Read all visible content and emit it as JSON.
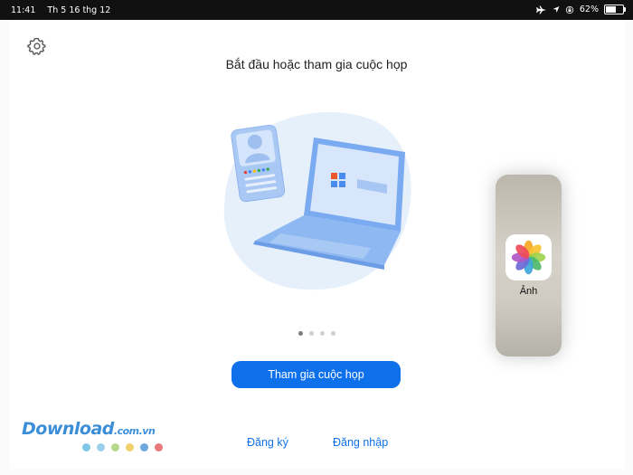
{
  "statusbar": {
    "time": "11:41",
    "date": "Th 5 16 thg 12",
    "battery": "62%",
    "battery_level": 0.62
  },
  "main": {
    "title": "Bắt đầu hoặc tham gia cuộc họp",
    "page_indicator": {
      "count": 4,
      "active": 0
    },
    "join_button": "Tham gia cuộc họp",
    "signup_link": "Đăng ký",
    "signin_link": "Đăng nhập"
  },
  "slideover": {
    "app_name": "Ảnh",
    "icon": "photos-app-icon"
  },
  "watermark": {
    "text_main": "Download",
    "text_domain": ".com.vn",
    "dot_colors": [
      "#7fc7e8",
      "#9bd0ea",
      "#b7d98d",
      "#f0d06a",
      "#6fa8dc",
      "#e8787a"
    ]
  },
  "colors": {
    "accent": "#0e71eb",
    "illustration_bg": "#e6f0fb",
    "illustration_blue": "#7aaaf0"
  }
}
